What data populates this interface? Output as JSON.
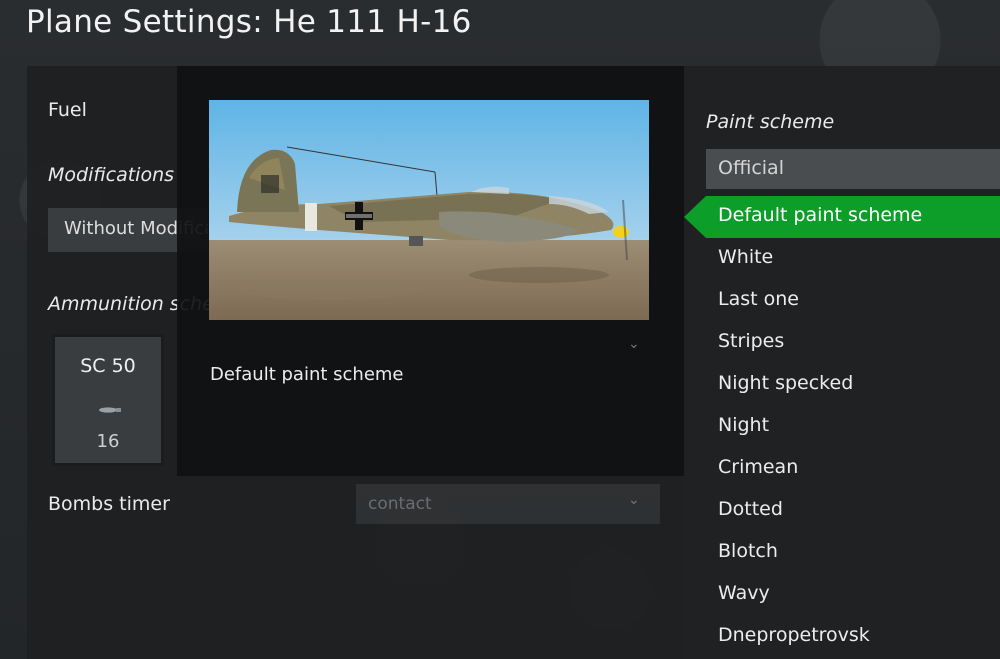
{
  "window": {
    "title": "Plane Settings: He 111 H-16"
  },
  "left_panel": {
    "fuel_label": "Fuel",
    "modifications_label": "Modifications",
    "modifications_value": "Without Modifications",
    "ammunition_label": "Ammunition scheme",
    "ammo": {
      "name": "SC 50",
      "count": "16",
      "icon": "bomb-icon"
    },
    "bombs_timer_label": "Bombs timer",
    "bombs_timer_value": "contact"
  },
  "preview": {
    "caption": "Default paint scheme",
    "image": "he-111-aircraft-preview"
  },
  "paint": {
    "label": "Paint scheme",
    "category": "Official",
    "selected_index": 0,
    "items": [
      "Default paint scheme",
      "White",
      "Last one",
      "Stripes",
      "Night specked",
      "Night",
      "Crimean",
      "Dotted",
      "Blotch",
      "Wavy",
      "Dnepropetrovsk"
    ]
  },
  "colors": {
    "accent": "#0d9e2a"
  }
}
